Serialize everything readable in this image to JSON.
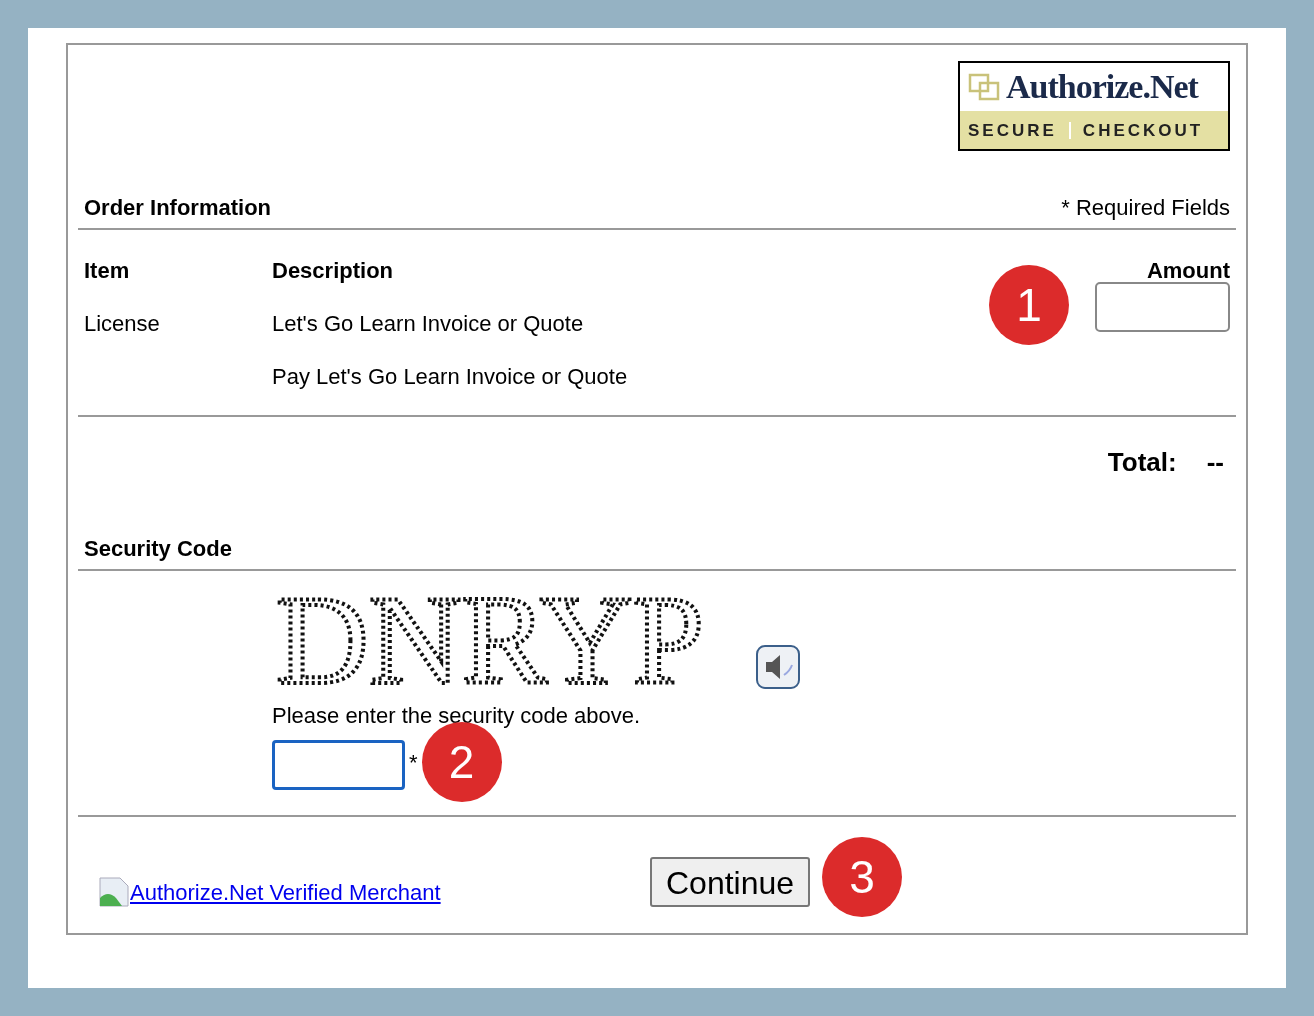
{
  "logo": {
    "brand": "Authorize.Net",
    "tagline_left": "SECURE",
    "tagline_right": "CHECKOUT"
  },
  "order": {
    "title": "Order Information",
    "required_note": "* Required Fields",
    "columns": [
      "Item",
      "Description",
      "Amount"
    ],
    "item": "License",
    "description": "Let's Go Learn Invoice or Quote",
    "note": "Pay Let's Go Learn Invoice or Quote",
    "total_label": "Total:",
    "total_value": "--"
  },
  "security": {
    "title": "Security Code",
    "captcha": "DNRYP",
    "instruction": "Please enter the security code above.",
    "required_mark": "*",
    "focused": true
  },
  "footer": {
    "seal_link": "Authorize.Net Verified Merchant",
    "continue_button": "Continue"
  },
  "markers": [
    "1",
    "2",
    "3"
  ]
}
